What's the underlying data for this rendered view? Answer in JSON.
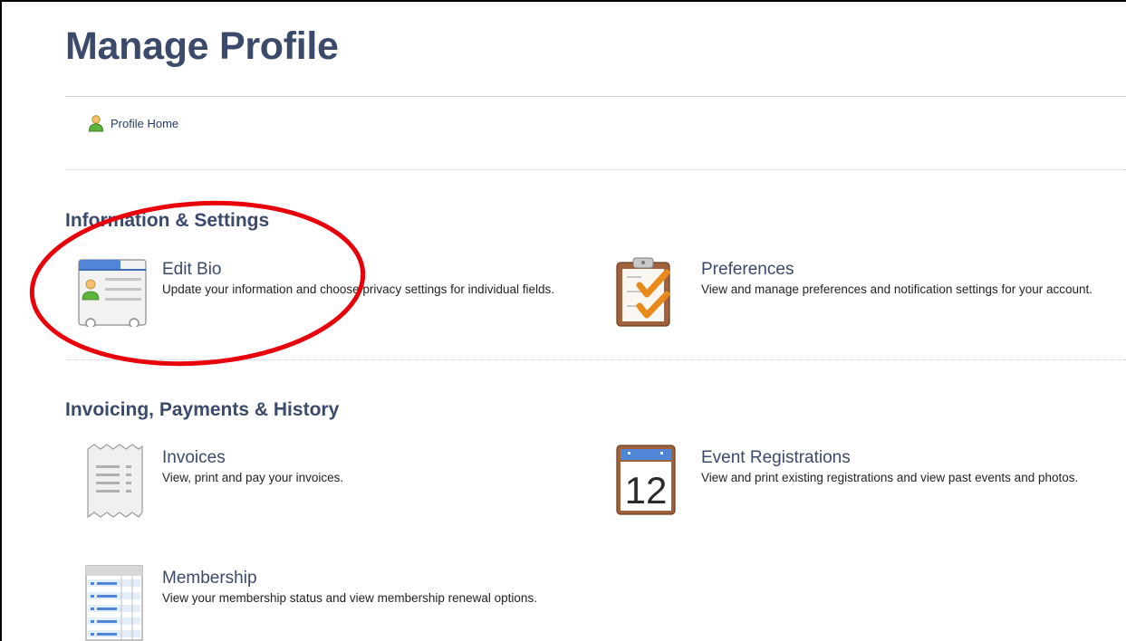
{
  "page": {
    "title": "Manage Profile"
  },
  "nav": {
    "profile_home": "Profile Home"
  },
  "sections": [
    {
      "title": "Information & Settings",
      "items": [
        {
          "label": "Edit Bio",
          "description": "Update your information and choose privacy settings for individual fields.",
          "icon": "bio-card-icon",
          "highlighted": true
        },
        {
          "label": "Preferences",
          "description": "View and manage preferences and notification settings for your account.",
          "icon": "clipboard-checklist-icon"
        }
      ]
    },
    {
      "title": "Invoicing, Payments & History",
      "items": [
        {
          "label": "Invoices",
          "description": "View, print and pay your invoices.",
          "icon": "receipt-icon"
        },
        {
          "label": "Event Registrations",
          "description": "View and print existing registrations and view past events and photos.",
          "icon": "calendar-icon",
          "calendar_day": "12"
        },
        {
          "label": "Membership",
          "description": "View your membership status and view membership renewal options.",
          "icon": "membership-table-icon"
        }
      ]
    }
  ],
  "colors": {
    "heading": "#3b4a6b",
    "link": "#2a3a66",
    "highlight_circle": "#e8000b"
  }
}
